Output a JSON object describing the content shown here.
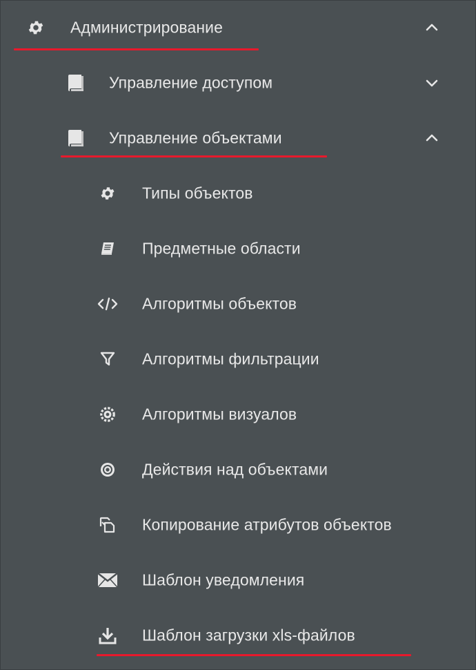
{
  "menu": {
    "admin": {
      "label": "Администрирование",
      "icon": "gear-icon",
      "expanded": true
    },
    "access": {
      "label": "Управление доступом",
      "icon": "book-icon",
      "expanded": false
    },
    "objects": {
      "label": "Управление объектами",
      "icon": "book-icon",
      "expanded": true
    },
    "items": [
      {
        "label": "Типы объектов",
        "icon": "gear-icon"
      },
      {
        "label": "Предметные области",
        "icon": "book-open-icon"
      },
      {
        "label": "Алгоритмы объектов",
        "icon": "code-icon"
      },
      {
        "label": "Алгоритмы фильтрации",
        "icon": "filter-icon"
      },
      {
        "label": "Алгоритмы визуалов",
        "icon": "cog-spin-icon"
      },
      {
        "label": "Действия над объектами",
        "icon": "target-icon"
      },
      {
        "label": "Копирование атрибутов объектов",
        "icon": "copy-icon"
      },
      {
        "label": "Шаблон уведомления",
        "icon": "envelope-icon"
      },
      {
        "label": "Шаблон загрузки xls-файлов",
        "icon": "download-icon"
      }
    ]
  },
  "colors": {
    "background": "#4a5053",
    "text": "#e8e8e8",
    "highlight_underline": "#e8192c"
  }
}
